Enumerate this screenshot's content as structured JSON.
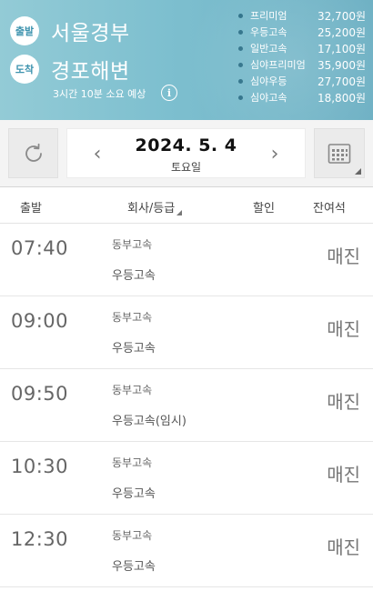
{
  "header": {
    "departure_badge": "출발",
    "departure_city": "서울경부",
    "arrival_badge": "도착",
    "arrival_city": "경포해변",
    "duration": "3시간 10분 소요 예상",
    "info_icon": "info-icon",
    "fares": [
      {
        "grade": "프리미엄",
        "price": "32,700원"
      },
      {
        "grade": "우등고속",
        "price": "25,200원"
      },
      {
        "grade": "일반고속",
        "price": "17,100원"
      },
      {
        "grade": "심야프리미엄",
        "price": "35,900원"
      },
      {
        "grade": "심야우등",
        "price": "27,700원"
      },
      {
        "grade": "심야고속",
        "price": "18,800원"
      }
    ]
  },
  "datebar": {
    "date": "2024. 5. 4",
    "weekday": "토요일",
    "prev": "‹",
    "next": "›",
    "refresh_icon": "refresh-icon",
    "calendar_icon": "calendar-icon"
  },
  "table": {
    "headers": {
      "departure": "출발",
      "company": "회사/등급",
      "discount": "할인",
      "seats": "잔여석"
    },
    "rows": [
      {
        "time": "07:40",
        "company": "동부고속",
        "grade": "우등고속",
        "status": "매진"
      },
      {
        "time": "09:00",
        "company": "동부고속",
        "grade": "우등고속",
        "status": "매진"
      },
      {
        "time": "09:50",
        "company": "동부고속",
        "grade": "우등고속(임시)",
        "status": "매진"
      },
      {
        "time": "10:30",
        "company": "동부고속",
        "grade": "우등고속",
        "status": "매진"
      },
      {
        "time": "12:30",
        "company": "동부고속",
        "grade": "우등고속",
        "status": "매진"
      }
    ]
  },
  "colors": {
    "header_bg": "#7dbfcf",
    "badge_text": "#3d93ae",
    "fare_dot": "#2b6f87"
  }
}
